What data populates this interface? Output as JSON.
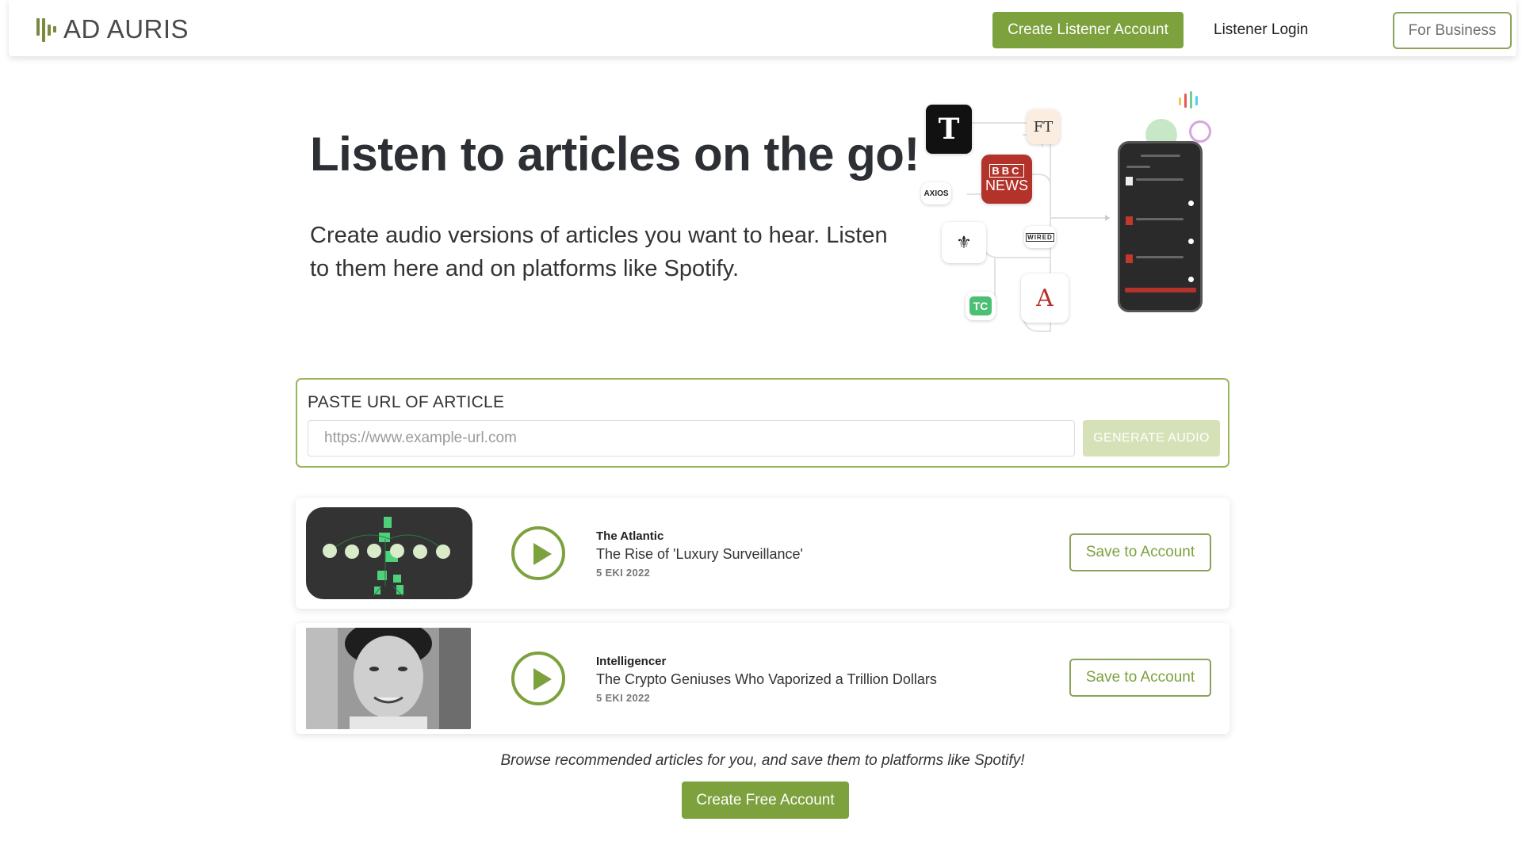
{
  "header": {
    "logo_text": "AD AURIS",
    "create_listener_label": "Create Listener Account",
    "login_label": "Listener Login",
    "business_label": "For Business"
  },
  "hero": {
    "title": "Listen to articles on the go!",
    "subtitle": "Create audio versions of articles you want to hear. Listen to them here and on platforms like Spotify."
  },
  "illustration": {
    "logos": [
      "nyt-logo",
      "ft-logo",
      "bbc-news-logo",
      "axios-logo",
      "new-yorker-logo",
      "wired-logo",
      "techcrunch-logo",
      "the-atlantic-logo",
      "spotify-logo",
      "google-podcasts-logo",
      "apple-podcasts-logo"
    ],
    "ft_text": "FT",
    "bbc_text_1": "BBC",
    "bbc_text_2": "NEWS",
    "axios_text": "AXIOS",
    "wired_text": "WIRED",
    "tc_text": "TC",
    "atlantic_text": "A"
  },
  "url_form": {
    "label": "PASTE URL OF ARTICLE",
    "placeholder": "https://www.example-url.com",
    "value": "",
    "generate_label": "GENERATE AUDIO"
  },
  "articles": [
    {
      "source": "The Atlantic",
      "title": "The Rise of 'Luxury Surveillance'",
      "date": "5 EKI 2022",
      "save_label": "Save to Account"
    },
    {
      "source": "Intelligencer",
      "title": "The Crypto Geniuses Who Vaporized a Trillion Dollars",
      "date": "5 EKI 2022",
      "save_label": "Save to Account"
    }
  ],
  "footer": {
    "browse_text": "Browse recommended articles for you, and save them to platforms like Spotify!",
    "create_free_label": "Create Free Account"
  },
  "colors": {
    "accent": "#7ca13d",
    "accent_light": "#d6e1b8",
    "border": "#9bb55c"
  }
}
